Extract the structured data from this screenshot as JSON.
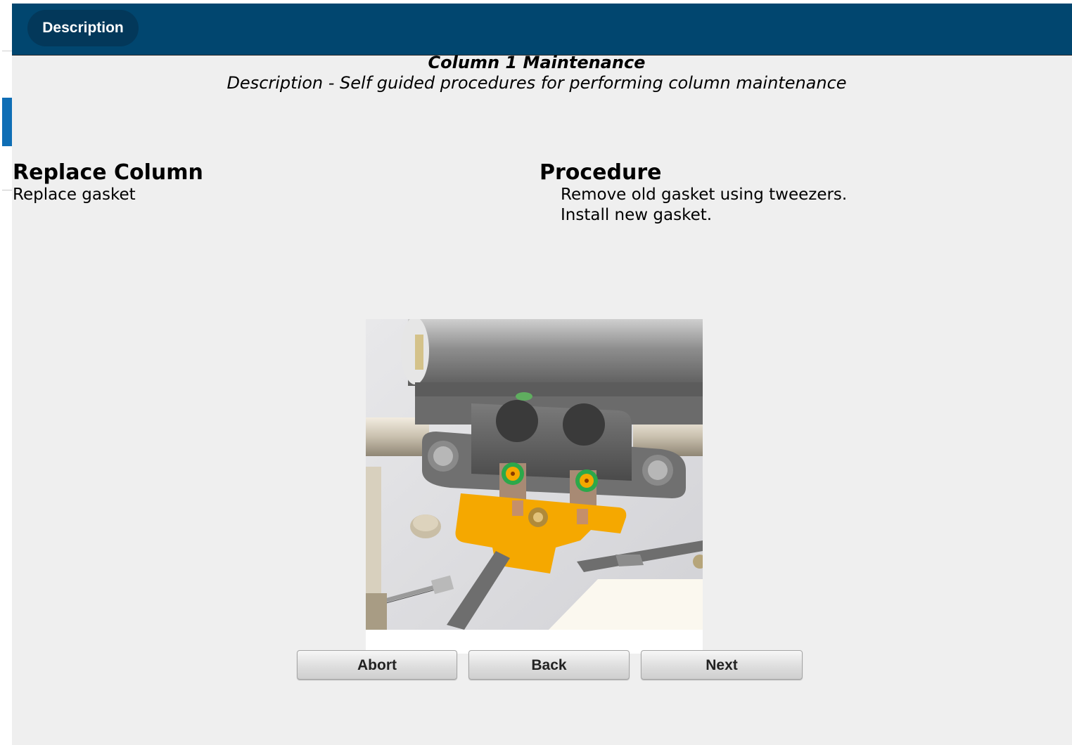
{
  "header": {
    "tab_label": "Description"
  },
  "page": {
    "title": "Column 1 Maintenance",
    "subtitle": "Description - Self guided procedures for performing column maintenance"
  },
  "step": {
    "title": "Replace Column",
    "subtitle": "Replace gasket"
  },
  "procedure": {
    "title": "Procedure",
    "lines": [
      "Remove old gasket using tweezers.",
      "Install new gasket."
    ]
  },
  "illustration": {
    "label": "Column gasket replacement illustration"
  },
  "buttons": {
    "abort": "Abort",
    "back": "Back",
    "next": "Next"
  },
  "colors": {
    "header": "#01466f",
    "tab": "#03385a",
    "accent": "#0f6eb5",
    "background": "#efefef",
    "gasket": "#f5a800"
  }
}
